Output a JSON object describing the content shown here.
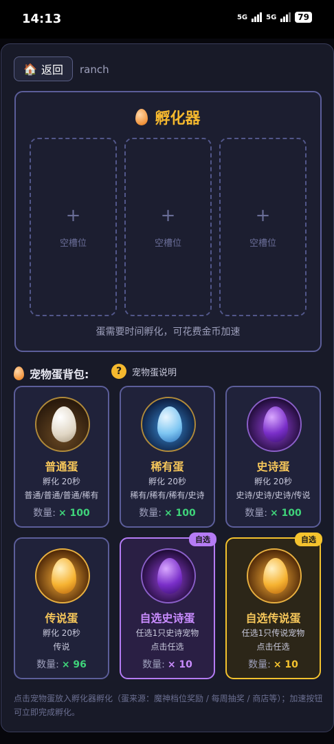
{
  "status": {
    "time": "14:13",
    "net1": "5G",
    "net2": "5G",
    "battery": "79"
  },
  "header": {
    "back_label": "返回",
    "back_icon": "house-icon",
    "page": "ranch"
  },
  "incubator": {
    "title": "孵化器",
    "slots": [
      {
        "plus": "+",
        "label": "空槽位"
      },
      {
        "plus": "+",
        "label": "空槽位"
      },
      {
        "plus": "+",
        "label": "空槽位"
      }
    ],
    "note": "蛋需要时间孵化，可花费金币加速"
  },
  "bag": {
    "title": "宠物蛋背包:",
    "help_icon": "?",
    "help_label": "宠物蛋说明"
  },
  "eggs": [
    {
      "name": "普通蛋",
      "line1": "孵化 20秒",
      "line2": "普通/普通/普通/稀有",
      "qty_label": "数量:",
      "qty": "× 100",
      "badge": ""
    },
    {
      "name": "稀有蛋",
      "line1": "孵化 20秒",
      "line2": "稀有/稀有/稀有/史诗",
      "qty_label": "数量:",
      "qty": "× 100",
      "badge": ""
    },
    {
      "name": "史诗蛋",
      "line1": "孵化 20秒",
      "line2": "史诗/史诗/史诗/传说",
      "qty_label": "数量:",
      "qty": "× 100",
      "badge": ""
    },
    {
      "name": "传说蛋",
      "line1": "孵化 20秒",
      "line2": "传说",
      "qty_label": "数量:",
      "qty": "× 96",
      "badge": ""
    },
    {
      "name": "自选史诗蛋",
      "line1": "任选1只史诗宠物",
      "line2": "点击任选",
      "qty_label": "数量:",
      "qty": "× 10",
      "badge": "自选"
    },
    {
      "name": "自选传说蛋",
      "line1": "任选1只传说宠物",
      "line2": "点击任选",
      "qty_label": "数量:",
      "qty": "× 10",
      "badge": "自选"
    }
  ],
  "footer": "点击宠物蛋放入孵化器孵化（蛋来源：魔神档位奖励 / 每周抽奖 / 商店等）；加速按钮可立即完成孵化。"
}
